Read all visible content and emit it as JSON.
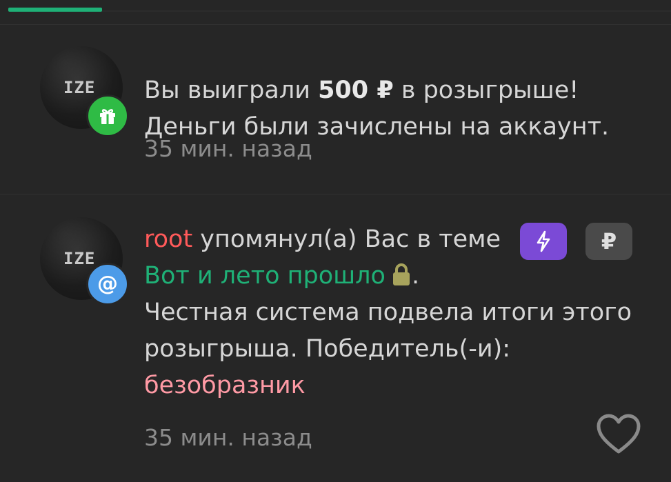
{
  "colors": {
    "accent_green": "#1fb177",
    "gift_badge": "#2fbb45",
    "mention_badge": "#4c9be8",
    "username_red": "#ff5a5a",
    "winner_pink": "#ff9aa5",
    "lightning_purple": "#7b4ad6",
    "ruble_pill": "#4a4a4a",
    "lock_olive": "#a7a35c"
  },
  "notifications": [
    {
      "avatar_text": "IZE",
      "badge_icon": "gift-icon",
      "text_before": "Вы выиграли ",
      "amount": "500 ₽",
      "text_after": " в розыгрыше!",
      "line2": "Деньги были зачислены на аккаунт.",
      "time": "35 мин. назад"
    },
    {
      "avatar_text": "IZE",
      "badge_icon": "at-icon",
      "badge_symbol": "@",
      "username": "root",
      "action_text": " упомянул(а) Вас в теме",
      "lightning_icon": "lightning-icon",
      "ruble_icon": "ruble-icon",
      "ruble_symbol": "₽",
      "thread_title": "Вот и лето прошло",
      "thread_punct": ".",
      "message_line1": "Честная система подвела итоги этого",
      "message_line2": "розыгрыша. Победитель(-и):",
      "winner": "безобразник",
      "time": "35 мин. назад",
      "like_icon": "heart-icon"
    }
  ]
}
